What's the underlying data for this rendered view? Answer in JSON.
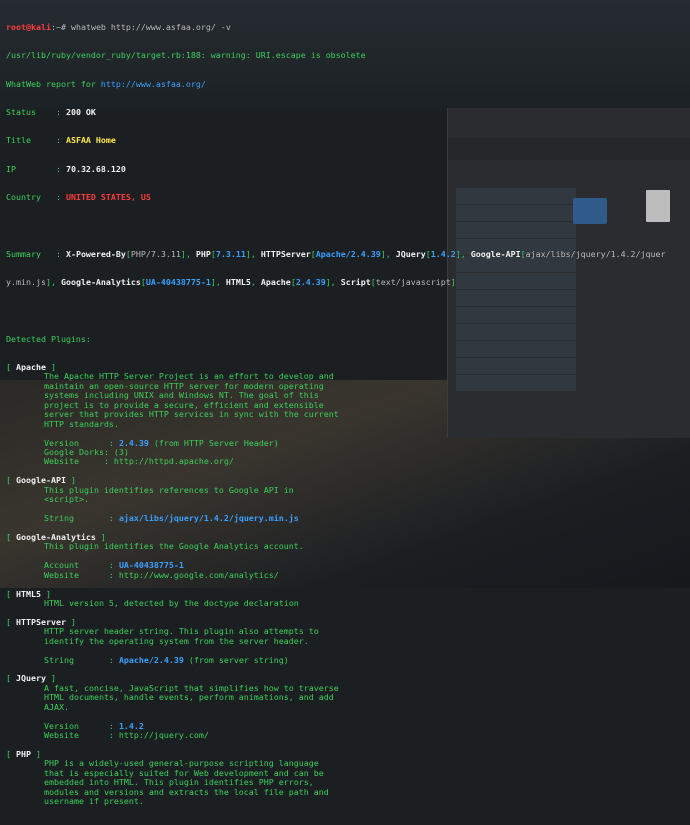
{
  "prompt": {
    "user": "root@kali",
    "path": ":~#",
    "command": " whatweb http://www.asfaa.org/ -v"
  },
  "warning": "/usr/lib/ruby/vendor_ruby/target.rb:188: warning: URI.escape is obsolete",
  "report": {
    "prefix": "WhatWeb report for ",
    "url": "http://www.asfaa.org/",
    "status_label": "Status    : ",
    "status": "200 OK",
    "title_label": "Title     : ",
    "title": "ASFAA Home",
    "ip_label": "IP        : ",
    "ip": "70.32.68.120",
    "country_label": "Country   : ",
    "country": "UNITED STATES, US"
  },
  "summary": {
    "label": "Summary   : ",
    "line1": [
      {
        "t": "X-Powered-By",
        "c": "white"
      },
      {
        "t": "[",
        "c": "green"
      },
      {
        "t": "PHP/7.3.11",
        "c": "grey"
      },
      {
        "t": "], ",
        "c": "green"
      },
      {
        "t": "PHP",
        "c": "white"
      },
      {
        "t": "[",
        "c": "green"
      },
      {
        "t": "7.3.11",
        "c": "ltblue"
      },
      {
        "t": "], ",
        "c": "green"
      },
      {
        "t": "HTTPServer",
        "c": "white"
      },
      {
        "t": "[",
        "c": "green"
      },
      {
        "t": "Apache/2.4.39",
        "c": "ltblue"
      },
      {
        "t": "], ",
        "c": "green"
      },
      {
        "t": "JQuery",
        "c": "white"
      },
      {
        "t": "[",
        "c": "green"
      },
      {
        "t": "1.4.2",
        "c": "ltblue"
      },
      {
        "t": "], ",
        "c": "green"
      },
      {
        "t": "Google-API",
        "c": "white"
      },
      {
        "t": "[",
        "c": "green"
      },
      {
        "t": "ajax/libs/jquery/1.4.2/jquer",
        "c": "grey"
      }
    ],
    "line2": [
      {
        "t": "y.min.js",
        "c": "grey"
      },
      {
        "t": "], ",
        "c": "green"
      },
      {
        "t": "Google-Analytics",
        "c": "white"
      },
      {
        "t": "[",
        "c": "green"
      },
      {
        "t": "UA-40438775-1",
        "c": "ltblue"
      },
      {
        "t": "], ",
        "c": "green"
      },
      {
        "t": "HTML5",
        "c": "white"
      },
      {
        "t": ", ",
        "c": "green"
      },
      {
        "t": "Apache",
        "c": "white"
      },
      {
        "t": "[",
        "c": "green"
      },
      {
        "t": "2.4.39",
        "c": "ltblue"
      },
      {
        "t": "], ",
        "c": "green"
      },
      {
        "t": "Script",
        "c": "white"
      },
      {
        "t": "[",
        "c": "green"
      },
      {
        "t": "text/javascript",
        "c": "grey"
      },
      {
        "t": "]",
        "c": "green"
      }
    ]
  },
  "detected_label": "Detected Plugins:",
  "plugins": [
    {
      "name": "Apache",
      "desc": [
        "The Apache HTTP Server Project is an effort to develop and",
        "maintain an open-source HTTP server for modern operating",
        "systems including UNIX and Windows NT. The goal of this",
        "project is to provide a secure, efficient and extensible",
        "server that provides HTTP services in sync with the current",
        "HTTP standards."
      ],
      "fields": [
        [
          {
            "t": "Version      : ",
            "c": "green"
          },
          {
            "t": "2.4.39",
            "c": "ltblue"
          },
          {
            "t": " (from HTTP Server Header)",
            "c": "green"
          }
        ],
        [
          {
            "t": "Google Dorks: (3)",
            "c": "green"
          }
        ],
        [
          {
            "t": "Website     : http://httpd.apache.org/",
            "c": "green"
          }
        ]
      ]
    },
    {
      "name": "Google-API",
      "desc": [
        "This plugin identifies references to Google API in",
        "<script>."
      ],
      "fields": [
        [
          {
            "t": "String       : ",
            "c": "green"
          },
          {
            "t": "ajax/libs/jquery/1.4.2/jquery.min.js",
            "c": "ltblue"
          }
        ]
      ]
    },
    {
      "name": "Google-Analytics",
      "desc": [
        "This plugin identifies the Google Analytics account."
      ],
      "fields": [
        [
          {
            "t": "Account      : ",
            "c": "green"
          },
          {
            "t": "UA-40438775-1",
            "c": "ltblue"
          }
        ],
        [
          {
            "t": "Website      : http://www.google.com/analytics/",
            "c": "green"
          }
        ]
      ]
    },
    {
      "name": "HTML5",
      "desc": [
        "HTML version 5, detected by the doctype declaration"
      ],
      "fields": []
    },
    {
      "name": "HTTPServer",
      "desc": [
        "HTTP server header string. This plugin also attempts to",
        "identify the operating system from the server header."
      ],
      "fields": [
        [
          {
            "t": "String       : ",
            "c": "green"
          },
          {
            "t": "Apache/2.4.39",
            "c": "ltblue"
          },
          {
            "t": " (from server string)",
            "c": "green"
          }
        ]
      ]
    },
    {
      "name": "JQuery",
      "desc": [
        "A fast, concise, JavaScript that simplifies how to traverse",
        "HTML documents, handle events, perform animations, and add",
        "AJAX."
      ],
      "fields": [
        [
          {
            "t": "Version      : ",
            "c": "green"
          },
          {
            "t": "1.4.2",
            "c": "ltblue"
          }
        ],
        [
          {
            "t": "Website      : http://jquery.com/",
            "c": "green"
          }
        ]
      ]
    },
    {
      "name": "PHP",
      "desc": [
        "PHP is a widely-used general-purpose scripting language",
        "that is especially suited for Web development and can be",
        "embedded into HTML. This plugin identifies PHP errors,",
        "modules and versions and extracts the local file path and",
        "username if present."
      ],
      "fields": []
    }
  ]
}
